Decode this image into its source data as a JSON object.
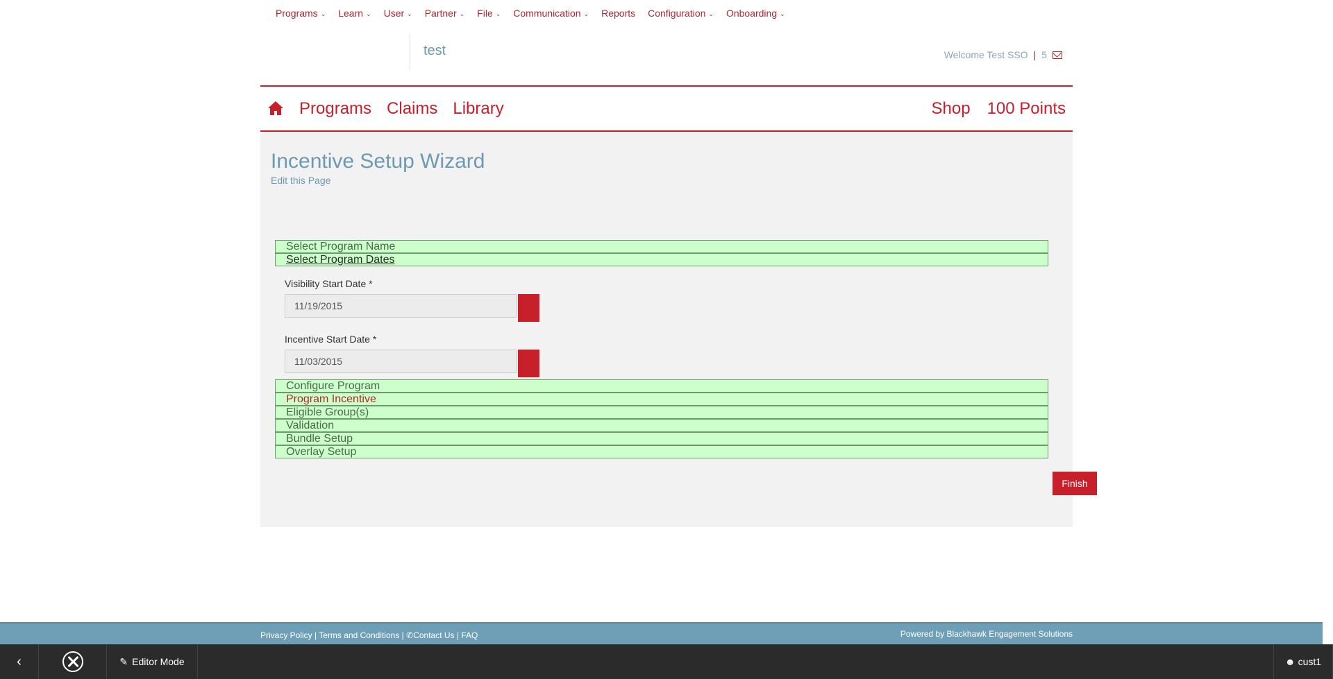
{
  "admin_menu": [
    {
      "label": "Programs",
      "dropdown": true
    },
    {
      "label": "Learn",
      "dropdown": true
    },
    {
      "label": "User",
      "dropdown": true
    },
    {
      "label": "Partner",
      "dropdown": true
    },
    {
      "label": "File",
      "dropdown": true
    },
    {
      "label": "Communication",
      "dropdown": true
    },
    {
      "label": "Reports",
      "dropdown": false
    },
    {
      "label": "Configuration",
      "dropdown": true
    },
    {
      "label": "Onboarding",
      "dropdown": true
    }
  ],
  "header": {
    "site_title": "test",
    "welcome": "Welcome Test SSO",
    "separator": "|",
    "message_count": "5"
  },
  "main_nav": {
    "left": [
      "Programs",
      "Claims",
      "Library"
    ],
    "right": [
      "Shop",
      "100 Points"
    ]
  },
  "page": {
    "title": "Incentive Setup Wizard",
    "edit_link": "Edit this Page"
  },
  "steps_top": [
    {
      "label": "Select Program Name"
    },
    {
      "label": "Select Program Dates"
    }
  ],
  "fields": {
    "visibility": {
      "label": "Visibility Start Date *",
      "value": "11/19/2015"
    },
    "incentive": {
      "label": "Incentive Start Date *",
      "value": "11/03/2015"
    }
  },
  "steps_bottom": [
    {
      "label": "Configure Program"
    },
    {
      "label": "Program Incentive"
    },
    {
      "label": "Eligible Group(s)"
    },
    {
      "label": "Validation"
    },
    {
      "label": "Bundle Setup"
    },
    {
      "label": "Overlay Setup"
    }
  ],
  "finish_label": "Finish",
  "footer": {
    "privacy": "Privacy Policy",
    "terms": "Terms and Conditions",
    "contact": "Contact Us",
    "faq": "FAQ",
    "sep": " | ",
    "powered": "Powered by Blackhawk Engagement Solutions"
  },
  "toolbar": {
    "back_icon": "chevron-left",
    "editor_label": "Editor Mode",
    "user_label": "cust1"
  },
  "colors": {
    "brand_red": "#c8202b",
    "step_green": "#ccffcc",
    "footer_blue": "#6f9fb7",
    "toolbar_dark": "#2b2b2b"
  }
}
